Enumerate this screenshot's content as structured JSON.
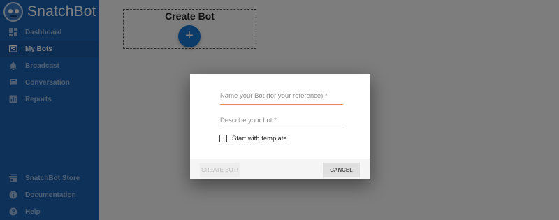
{
  "app": {
    "name": "SnatchBot"
  },
  "sidebar": {
    "top_items": [
      {
        "label": "Dashboard",
        "icon": "dashboard-icon",
        "active": false
      },
      {
        "label": "My Bots",
        "icon": "bots-icon",
        "active": true
      },
      {
        "label": "Broadcast",
        "icon": "bell-icon",
        "active": false
      },
      {
        "label": "Conversation",
        "icon": "chat-icon",
        "active": false
      },
      {
        "label": "Reports",
        "icon": "reports-icon",
        "active": false
      }
    ],
    "bottom_items": [
      {
        "label": "SnatchBot Store",
        "icon": "store-icon"
      },
      {
        "label": "Documentation",
        "icon": "info-icon"
      },
      {
        "label": "Help",
        "icon": "help-icon"
      }
    ]
  },
  "main": {
    "create_card": {
      "title": "Create Bot",
      "fab_symbol": "+"
    }
  },
  "dialog": {
    "name_field": {
      "label": "Name your Bot (for your reference) *"
    },
    "description_field": {
      "label": "Describe your bot *"
    },
    "template_checkbox": {
      "label": "Start with template",
      "checked": false
    },
    "create_button": "CREATE BOT!",
    "cancel_button": "CANCEL"
  },
  "colors": {
    "sidebar": "#1c63b5",
    "accent": "#1976d2",
    "focus_underline": "#f18a5d"
  }
}
